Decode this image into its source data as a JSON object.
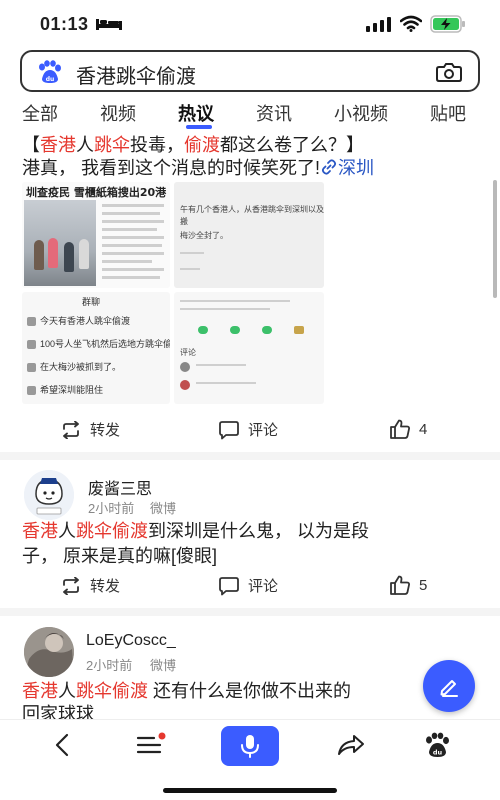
{
  "status_bar": {
    "time": "01:13"
  },
  "search": {
    "query": "香港跳伞偷渡"
  },
  "tabs": [
    {
      "label": "全部",
      "active": false
    },
    {
      "label": "视频",
      "active": false
    },
    {
      "label": "热议",
      "active": true
    },
    {
      "label": "资讯",
      "active": false
    },
    {
      "label": "小视频",
      "active": false
    },
    {
      "label": "贴吧",
      "active": false
    }
  ],
  "post1": {
    "title_parts": [
      "【",
      "香港",
      "人",
      "跳伞",
      "投毒，",
      "偷渡",
      "都这么卷了么？】"
    ],
    "body": "港真， 我看到这个消息的时候笑死了!",
    "location": "深圳",
    "image_headline": "圳查疫民 雪櫃紙箱搜出20港",
    "image_chat_title": "群聊",
    "image_chat_rows": [
      "今天有香港人跳伞偷渡",
      "100号人坐飞机然后选地方跳伞偷渡吗?",
      "在大梅沙被抓到了。",
      "希望深圳能阻住"
    ],
    "image_right_text": [
      "午有几个香港人，从香港跳伞到深圳以及",
      "搬",
      "梅沙全封了。"
    ],
    "image_comment_label": "评论",
    "actions": {
      "repost": "转发",
      "comment": "评论",
      "likes": "4"
    }
  },
  "post2": {
    "user": "废酱三思",
    "time": "2小时前",
    "source": "微博",
    "text_parts": [
      "香港",
      "人",
      "跳伞偷渡",
      "到深圳是什么鬼， 以为是段"
    ],
    "text_line2": "子， 原来是真的嘛[傻眼]",
    "actions": {
      "repost": "转发",
      "comment": "评论",
      "likes": "5"
    }
  },
  "post3": {
    "user": "LoEyCoscc_",
    "time": "2小时前",
    "source": "微博",
    "text_parts": [
      "香港",
      "人",
      "跳伞偷渡",
      " 还有什么是你做不出来的"
    ],
    "text_line2": "回家球球"
  },
  "colors": {
    "accent": "#3b5cff",
    "highlight": "#e5372e",
    "link": "#2a57c4"
  }
}
